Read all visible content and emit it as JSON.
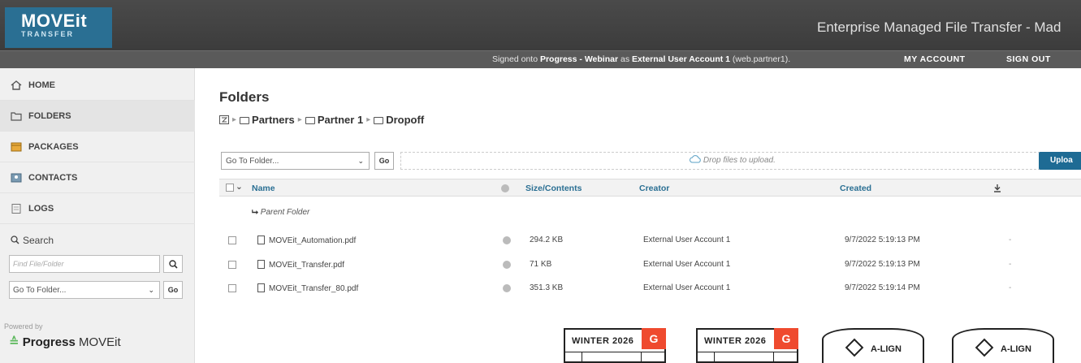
{
  "header": {
    "logo_main": "MOVEit",
    "logo_sub": "TRANSFER",
    "app_title": "Enterprise Managed File Transfer - Mad"
  },
  "userbar": {
    "signed_prefix": "Signed onto ",
    "org": "Progress - Webinar",
    "signed_mid": " as ",
    "user": "External User Account 1",
    "signed_suffix": " (web.partner1).",
    "my_account": "MY ACCOUNT",
    "sign_out": "SIGN OUT"
  },
  "sidebar": {
    "items": [
      {
        "label": "HOME",
        "icon": "home-icon"
      },
      {
        "label": "FOLDERS",
        "icon": "folder-icon"
      },
      {
        "label": "PACKAGES",
        "icon": "package-icon"
      },
      {
        "label": "CONTACTS",
        "icon": "contacts-icon"
      },
      {
        "label": "LOGS",
        "icon": "logs-icon"
      }
    ],
    "search_label": "Search",
    "search_placeholder": "Find File/Folder",
    "goto_value": "Go To Folder...",
    "go_label": "Go",
    "powered_by": "Powered by",
    "brand": "Progress",
    "brand_product": "MOVEit"
  },
  "main": {
    "title": "Folders",
    "breadcrumb": [
      "Partners",
      "Partner 1",
      "Dropoff"
    ],
    "goto_value": "Go To Folder...",
    "go_label": "Go",
    "drop_text": "Drop files to upload.",
    "upload_label": "Uploa",
    "columns": {
      "name": "Name",
      "size": "Size/Contents",
      "creator": "Creator",
      "created": "Created"
    },
    "parent_folder": "Parent Folder",
    "rows": [
      {
        "name": "MOVEit_Automation.pdf",
        "size": "294.2 KB",
        "creator": "External User Account 1",
        "created": "9/7/2022 5:19:13 PM",
        "dl": "-"
      },
      {
        "name": "MOVEit_Transfer.pdf",
        "size": "71 KB",
        "creator": "External User Account 1",
        "created": "9/7/2022 5:19:13 PM",
        "dl": "-"
      },
      {
        "name": "MOVEit_Transfer_80.pdf",
        "size": "351.3 KB",
        "creator": "External User Account 1",
        "created": "9/7/2022 5:19:14 PM",
        "dl": "-"
      }
    ]
  },
  "badges": {
    "g2_1": "WINTER 2026",
    "g2_2": "WINTER 2026",
    "g2_mark": "G",
    "align_1": "A-LIGN",
    "align_2": "A-LIGN"
  },
  "colors": {
    "header": "#3c3c3c",
    "logo": "#2a6f93",
    "link": "#2a6f93",
    "upload": "#1e6b94",
    "g2": "#ef4a2e"
  }
}
